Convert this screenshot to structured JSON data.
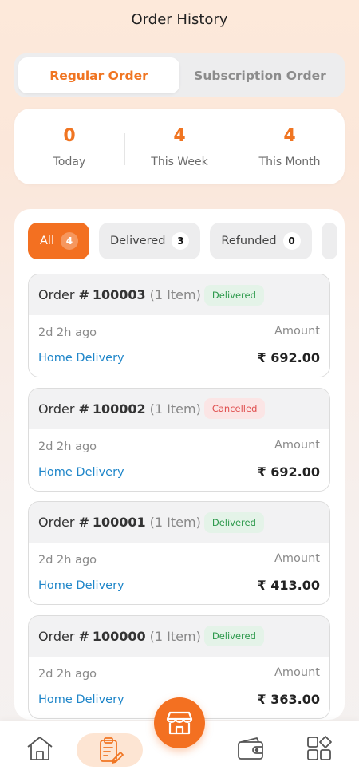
{
  "header": {
    "title": "Order History"
  },
  "segments": {
    "regular": "Regular Order",
    "subscription": "Subscription Order"
  },
  "stats": [
    {
      "value": "0",
      "label": "Today"
    },
    {
      "value": "4",
      "label": "This Week"
    },
    {
      "value": "4",
      "label": "This Month"
    }
  ],
  "filters": [
    {
      "label": "All",
      "count": "4"
    },
    {
      "label": "Delivered",
      "count": "3"
    },
    {
      "label": "Refunded",
      "count": "0"
    }
  ],
  "orders": [
    {
      "word": "Order",
      "hash": "#",
      "number": "100003",
      "items": "(1 Item)",
      "status": "Delivered",
      "ago": "2d 2h ago",
      "delivery": "Home Delivery",
      "amount_label": "Amount",
      "amount": "₹ 692.00"
    },
    {
      "word": "Order",
      "hash": "#",
      "number": "100002",
      "items": "(1 Item)",
      "status": "Cancelled",
      "ago": "2d 2h ago",
      "delivery": "Home Delivery",
      "amount_label": "Amount",
      "amount": "₹ 692.00"
    },
    {
      "word": "Order",
      "hash": "#",
      "number": "100001",
      "items": "(1 Item)",
      "status": "Delivered",
      "ago": "2d 2h ago",
      "delivery": "Home Delivery",
      "amount_label": "Amount",
      "amount": "₹ 413.00"
    },
    {
      "word": "Order",
      "hash": "#",
      "number": "100000",
      "items": "(1 Item)",
      "status": "Delivered",
      "ago": "2d 2h ago",
      "delivery": "Home Delivery",
      "amount_label": "Amount",
      "amount": "₹ 363.00"
    }
  ],
  "nav": {
    "items": [
      "home-icon",
      "orders-icon",
      "store-icon",
      "wallet-icon",
      "menu-grid-icon"
    ],
    "active": "orders-icon"
  },
  "colors": {
    "accent": "#f37021",
    "link": "#1f86c9",
    "delivered": "#2e9a4d",
    "cancelled": "#e05050"
  }
}
